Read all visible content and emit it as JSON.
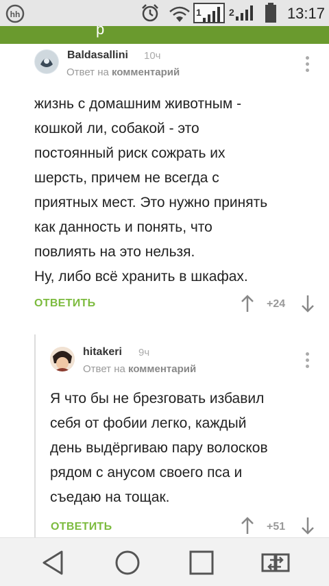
{
  "status_bar": {
    "time": "13:17",
    "sim1_label": "1",
    "sim2_label": "2",
    "icons": [
      "hh-app-icon",
      "alarm-icon",
      "wifi-icon",
      "signal-sim1-icon",
      "signal-sim2-icon",
      "battery-icon"
    ]
  },
  "toolbar": {
    "title_fragment": "р"
  },
  "comments": [
    {
      "author": "Baldasallini",
      "age": "10ч",
      "reply_prefix": "Ответ на",
      "reply_target": "комментарий",
      "text": "жизнь с домашним животным -\nкошкой ли, собакой - это\nпостоянный риск сожрать их\nшерсть, причем не всегда с\nприятных мест. Это нужно принять\nкак данность и понять, что\nповлиять на это нельзя.\nНу, либо всё хранить в шкафах.",
      "reply_label": "ОТВЕТИТЬ",
      "score": "+24"
    },
    {
      "author": "hitakeri",
      "age": "9ч",
      "reply_prefix": "Ответ на",
      "reply_target": "комментарий",
      "text": "Я что бы не брезговать избавил\nсебя от фобии легко, каждый\nдень выдёргиваю пару волосков\nрядом с анусом своего пса и\nсъедаю на тощак.",
      "reply_label": "ОТВЕТИТЬ",
      "score": "+51"
    }
  ],
  "colors": {
    "accent": "#7cbb3e",
    "toolbar": "#6a9a2e"
  },
  "nav_bar": {
    "icons": [
      "back-icon",
      "home-icon",
      "recents-icon",
      "switch-sim-icon"
    ]
  }
}
